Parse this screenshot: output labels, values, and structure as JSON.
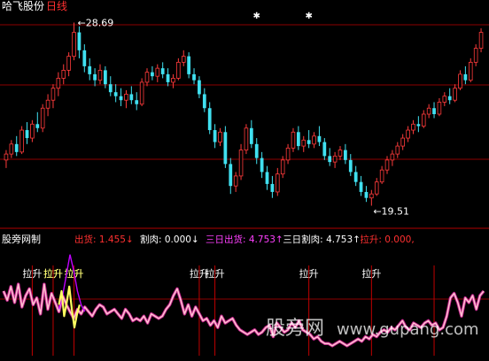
{
  "header": {
    "stock_name": "哈飞股份",
    "period": "日线",
    "high_label": "28.69",
    "low_label": "19.51"
  },
  "indicator": {
    "name": "股旁网制",
    "fields": [
      {
        "label": "出货:",
        "value": "1.455",
        "arrow": "↓",
        "color": "#ff3030"
      },
      {
        "label": "割肉:",
        "value": "0.000",
        "arrow": "↓",
        "color": "#ffffff"
      },
      {
        "label": "三日出货:",
        "value": "4.753",
        "arrow": "↑",
        "color": "#ff40ff"
      },
      {
        "label": "三日割肉:",
        "value": "4.753",
        "arrow": "↑",
        "color": "#ffffff"
      },
      {
        "label": "拉升:",
        "value": "0.000,",
        "arrow": "",
        "color": "#ff3030"
      }
    ],
    "signal_label": "拉升"
  },
  "watermark": {
    "cn": "股旁网",
    "url": "www.gupang.com"
  },
  "colors": {
    "up": "#ff3b3b",
    "down": "#40e0f0",
    "grid": "#8b0000",
    "main_line": "#ffc0d0",
    "purple_line": "#c000ff",
    "yellow_line": "#ffff60"
  },
  "chart_data": {
    "type": "candlestick",
    "price_high": 28.69,
    "price_low": 19.51,
    "candles": [
      [
        21.8,
        22.3,
        21.4,
        22.1
      ],
      [
        22.1,
        22.8,
        21.9,
        22.6
      ],
      [
        22.6,
        23.0,
        22.0,
        22.2
      ],
      [
        22.2,
        23.5,
        22.1,
        23.3
      ],
      [
        23.3,
        23.7,
        22.6,
        22.9
      ],
      [
        22.9,
        23.8,
        22.7,
        23.6
      ],
      [
        23.6,
        24.2,
        23.2,
        23.4
      ],
      [
        23.4,
        24.6,
        23.2,
        24.4
      ],
      [
        24.4,
        25.1,
        24.0,
        24.8
      ],
      [
        24.8,
        25.6,
        24.4,
        25.4
      ],
      [
        25.4,
        26.2,
        25.0,
        25.9
      ],
      [
        25.9,
        26.6,
        25.6,
        26.3
      ],
      [
        26.3,
        27.2,
        26.0,
        27.0
      ],
      [
        27.0,
        28.69,
        26.8,
        28.2
      ],
      [
        28.2,
        28.5,
        26.9,
        27.3
      ],
      [
        27.3,
        27.6,
        26.2,
        26.5
      ],
      [
        26.5,
        26.9,
        25.8,
        26.1
      ],
      [
        26.1,
        26.4,
        25.5,
        25.8
      ],
      [
        25.8,
        26.6,
        25.6,
        26.3
      ],
      [
        26.3,
        26.5,
        25.4,
        25.6
      ],
      [
        25.6,
        26.0,
        25.0,
        25.2
      ],
      [
        25.2,
        25.6,
        24.7,
        25.0
      ],
      [
        25.0,
        25.4,
        24.5,
        24.8
      ],
      [
        24.8,
        25.3,
        24.4,
        25.1
      ],
      [
        25.1,
        25.5,
        24.6,
        24.8
      ],
      [
        24.8,
        25.2,
        24.3,
        24.6
      ],
      [
        24.6,
        25.9,
        24.5,
        25.7
      ],
      [
        25.7,
        26.4,
        25.5,
        26.2
      ],
      [
        26.2,
        26.5,
        25.8,
        26.0
      ],
      [
        26.0,
        26.6,
        25.7,
        26.4
      ],
      [
        26.4,
        26.7,
        25.9,
        26.1
      ],
      [
        26.1,
        26.4,
        25.5,
        25.7
      ],
      [
        25.7,
        26.1,
        25.4,
        25.9
      ],
      [
        25.9,
        26.9,
        25.8,
        26.7
      ],
      [
        26.7,
        27.3,
        26.5,
        27.0
      ],
      [
        27.0,
        27.2,
        25.9,
        26.1
      ],
      [
        26.1,
        26.4,
        25.6,
        25.8
      ],
      [
        25.8,
        26.0,
        24.9,
        25.1
      ],
      [
        25.1,
        25.4,
        24.2,
        24.4
      ],
      [
        24.4,
        24.7,
        23.1,
        23.3
      ],
      [
        23.3,
        23.6,
        22.4,
        22.7
      ],
      [
        22.7,
        23.4,
        22.5,
        23.2
      ],
      [
        23.2,
        23.5,
        21.4,
        21.6
      ],
      [
        21.6,
        21.9,
        20.1,
        20.5
      ],
      [
        20.5,
        21.2,
        20.2,
        21.0
      ],
      [
        21.0,
        22.6,
        20.8,
        22.3
      ],
      [
        22.3,
        23.6,
        22.1,
        23.4
      ],
      [
        23.4,
        23.8,
        22.4,
        22.6
      ],
      [
        22.6,
        22.9,
        21.6,
        21.9
      ],
      [
        21.9,
        22.2,
        20.9,
        21.2
      ],
      [
        21.2,
        21.5,
        20.3,
        20.6
      ],
      [
        20.6,
        21.0,
        19.9,
        20.2
      ],
      [
        20.2,
        21.4,
        20.0,
        21.1
      ],
      [
        21.1,
        22.0,
        20.9,
        21.8
      ],
      [
        21.8,
        22.6,
        21.6,
        22.4
      ],
      [
        22.4,
        23.4,
        22.2,
        23.2
      ],
      [
        23.2,
        23.5,
        22.3,
        22.5
      ],
      [
        22.5,
        23.0,
        22.2,
        22.8
      ],
      [
        22.8,
        23.3,
        22.4,
        22.6
      ],
      [
        22.6,
        23.2,
        22.4,
        23.0
      ],
      [
        23.0,
        23.5,
        22.5,
        22.7
      ],
      [
        22.7,
        22.9,
        21.8,
        22.0
      ],
      [
        22.0,
        22.4,
        21.5,
        21.7
      ],
      [
        21.7,
        22.2,
        21.4,
        22.0
      ],
      [
        22.0,
        22.5,
        21.8,
        22.3
      ],
      [
        22.3,
        22.6,
        21.6,
        21.8
      ],
      [
        21.8,
        22.1,
        21.0,
        21.2
      ],
      [
        21.2,
        21.5,
        20.5,
        20.7
      ],
      [
        20.7,
        21.0,
        20.0,
        20.2
      ],
      [
        20.2,
        20.5,
        19.7,
        19.9
      ],
      [
        19.9,
        20.3,
        19.51,
        20.1
      ],
      [
        20.1,
        20.9,
        20.0,
        20.7
      ],
      [
        20.7,
        21.5,
        20.6,
        21.3
      ],
      [
        21.3,
        22.0,
        21.1,
        21.8
      ],
      [
        21.8,
        22.3,
        21.5,
        22.1
      ],
      [
        22.1,
        22.7,
        21.9,
        22.5
      ],
      [
        22.5,
        23.1,
        22.3,
        22.9
      ],
      [
        22.9,
        23.5,
        22.7,
        23.3
      ],
      [
        23.3,
        23.8,
        23.1,
        23.6
      ],
      [
        23.6,
        24.0,
        23.2,
        23.5
      ],
      [
        23.5,
        24.3,
        23.4,
        24.1
      ],
      [
        24.1,
        24.6,
        23.9,
        24.4
      ],
      [
        24.4,
        24.7,
        23.9,
        24.1
      ],
      [
        24.1,
        24.9,
        24.0,
        24.7
      ],
      [
        24.7,
        25.2,
        24.5,
        25.0
      ],
      [
        25.0,
        25.4,
        24.6,
        24.8
      ],
      [
        24.8,
        25.6,
        24.7,
        25.4
      ],
      [
        25.4,
        26.3,
        25.3,
        26.1
      ],
      [
        26.1,
        26.5,
        25.6,
        25.8
      ],
      [
        25.8,
        26.9,
        25.7,
        26.7
      ],
      [
        26.7,
        27.6,
        26.5,
        27.4
      ],
      [
        27.4,
        28.4,
        27.2,
        28.2
      ]
    ],
    "stars_at": [
      48,
      58,
      100,
      106,
      116
    ],
    "indicator_line": [
      2.6,
      2.2,
      2.8,
      2.1,
      2.9,
      1.9,
      2.4,
      2.7,
      2.0,
      2.3,
      1.6,
      2.9,
      1.8,
      2.5,
      2.1,
      1.7,
      2.4,
      2.0,
      1.7,
      1.4,
      1.8,
      1.6,
      1.9,
      1.7,
      1.5,
      1.8,
      2.0,
      1.9,
      1.6,
      1.7,
      1.8,
      1.6,
      1.4,
      1.8,
      1.6,
      1.3,
      1.4,
      1.3,
      1.5,
      1.2,
      1.6,
      1.5,
      1.4,
      1.5,
      1.8,
      2.0,
      2.4,
      2.7,
      2.2,
      1.6,
      2.0,
      1.5,
      1.9,
      1.6,
      1.3,
      1.4,
      1.1,
      1.3,
      1.0,
      1.5,
      1.2,
      1.3,
      1.4,
      1.1,
      0.9,
      0.8,
      0.7,
      0.8,
      0.9,
      0.7,
      0.8,
      1.0,
      1.1,
      0.6,
      1.2,
      1.0,
      0.8,
      0.9,
      1.2,
      1.0,
      1.3,
      0.9,
      0.8,
      0.7,
      0.5,
      0.6,
      0.4,
      0.3,
      0.3,
      0.2,
      0.3,
      0.4,
      0.3,
      0.2,
      0.3,
      0.4,
      0.5,
      0.4,
      0.6,
      0.5,
      0.7,
      0.6,
      0.8,
      0.9,
      0.8,
      1.0,
      0.9,
      1.1,
      1.3,
      1.0,
      0.9,
      1.2,
      1.1,
      1.0,
      1.2,
      1.3,
      1.1,
      1.2,
      0.9,
      1.0,
      1.5,
      2.3,
      2.5,
      2.1,
      1.5,
      2.3,
      2.1,
      2.4,
      1.8,
      2.4,
      2.6
    ],
    "purple_spike": {
      "start": 15,
      "values": [
        1.8,
        2.4,
        3.3,
        4.2,
        3.5,
        2.6,
        2.0,
        1.7
      ]
    },
    "yellow_wave": {
      "start": 15,
      "values": [
        2.0,
        2.6,
        1.5,
        2.1,
        2.8,
        1.8,
        1.0,
        1.6,
        2.0
      ]
    },
    "signal_positions": [
      5,
      9,
      13,
      37,
      40,
      58,
      70,
      82,
      109
    ],
    "signal_labels_at": [
      5,
      9,
      13,
      37,
      40,
      58,
      70,
      109
    ],
    "indicator_range": [
      0,
      4.5
    ]
  }
}
